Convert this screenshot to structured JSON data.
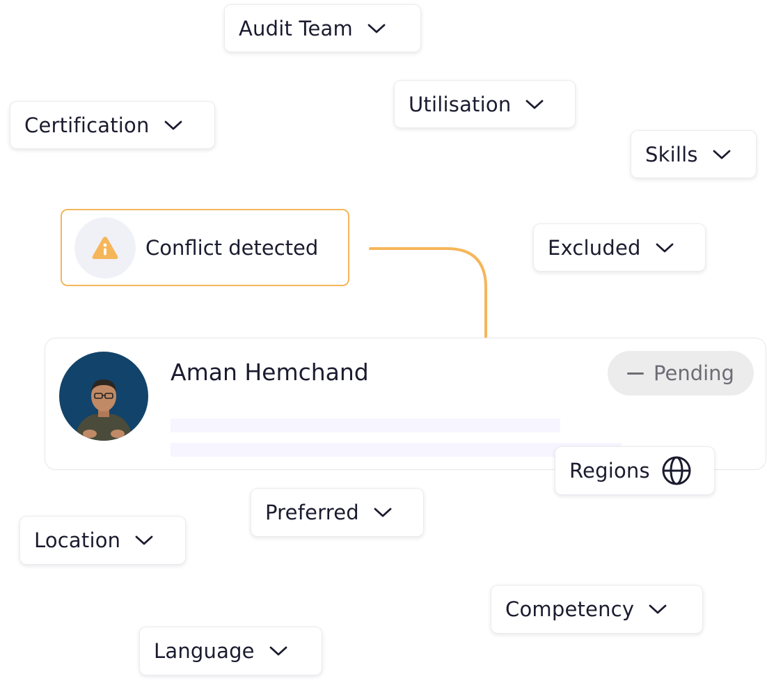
{
  "conflict": {
    "label": "Conflict detected",
    "icon": "warning-icon",
    "accent": "#f5b65a"
  },
  "profile": {
    "name": "Aman Hemchand",
    "status": "Pending",
    "avatar_bg": "#12436a"
  },
  "filters": {
    "audit_team": "Audit Team",
    "utilisation": "Utilisation",
    "certification": "Certification",
    "skills": "Skills",
    "excluded": "Excluded",
    "regions": "Regions",
    "preferred": "Preferred",
    "location": "Location",
    "competency": "Competency",
    "language": "Language"
  }
}
